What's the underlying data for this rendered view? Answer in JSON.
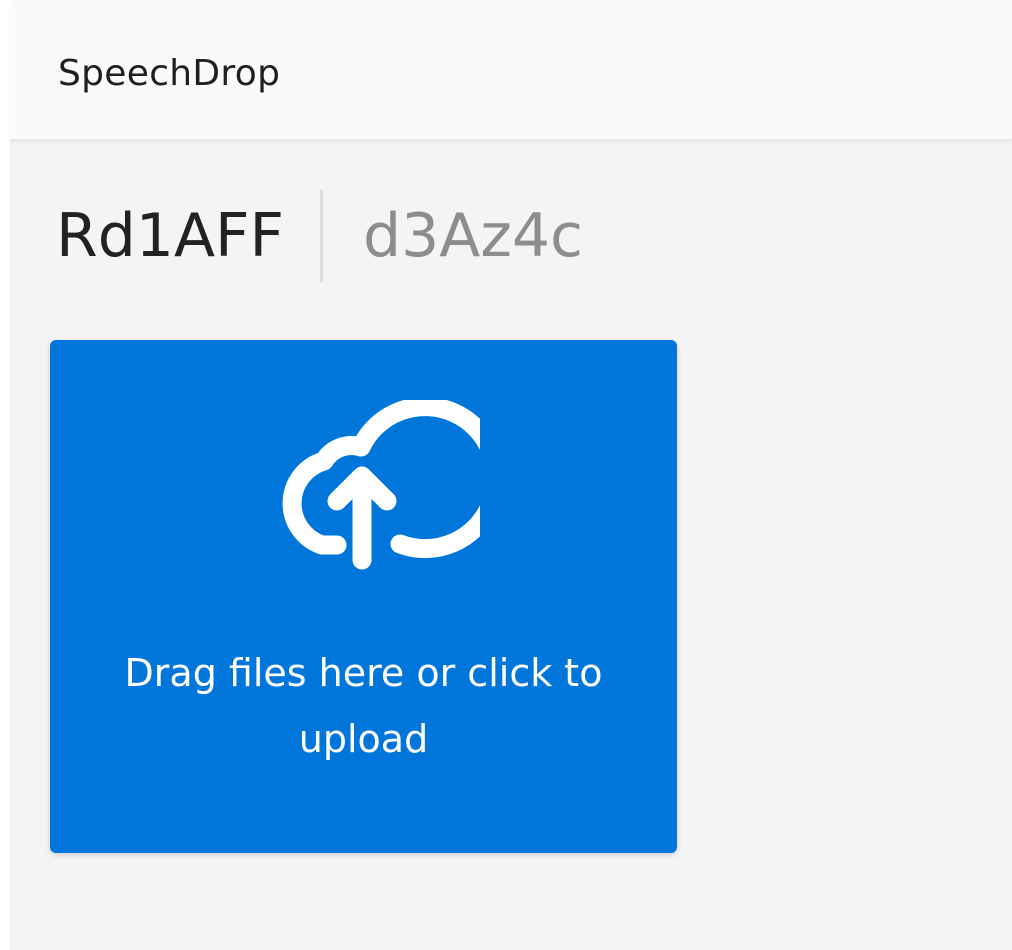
{
  "app": {
    "title": "SpeechDrop"
  },
  "room": {
    "admin_code": "Rd1AFF",
    "room_code": "d3Az4c"
  },
  "upload": {
    "icon": "cloud-upload-icon",
    "label": "Drag files here or click to upload"
  },
  "colors": {
    "accent": "#0076db",
    "background": "#f4f4f4",
    "header": "#fafafa"
  }
}
